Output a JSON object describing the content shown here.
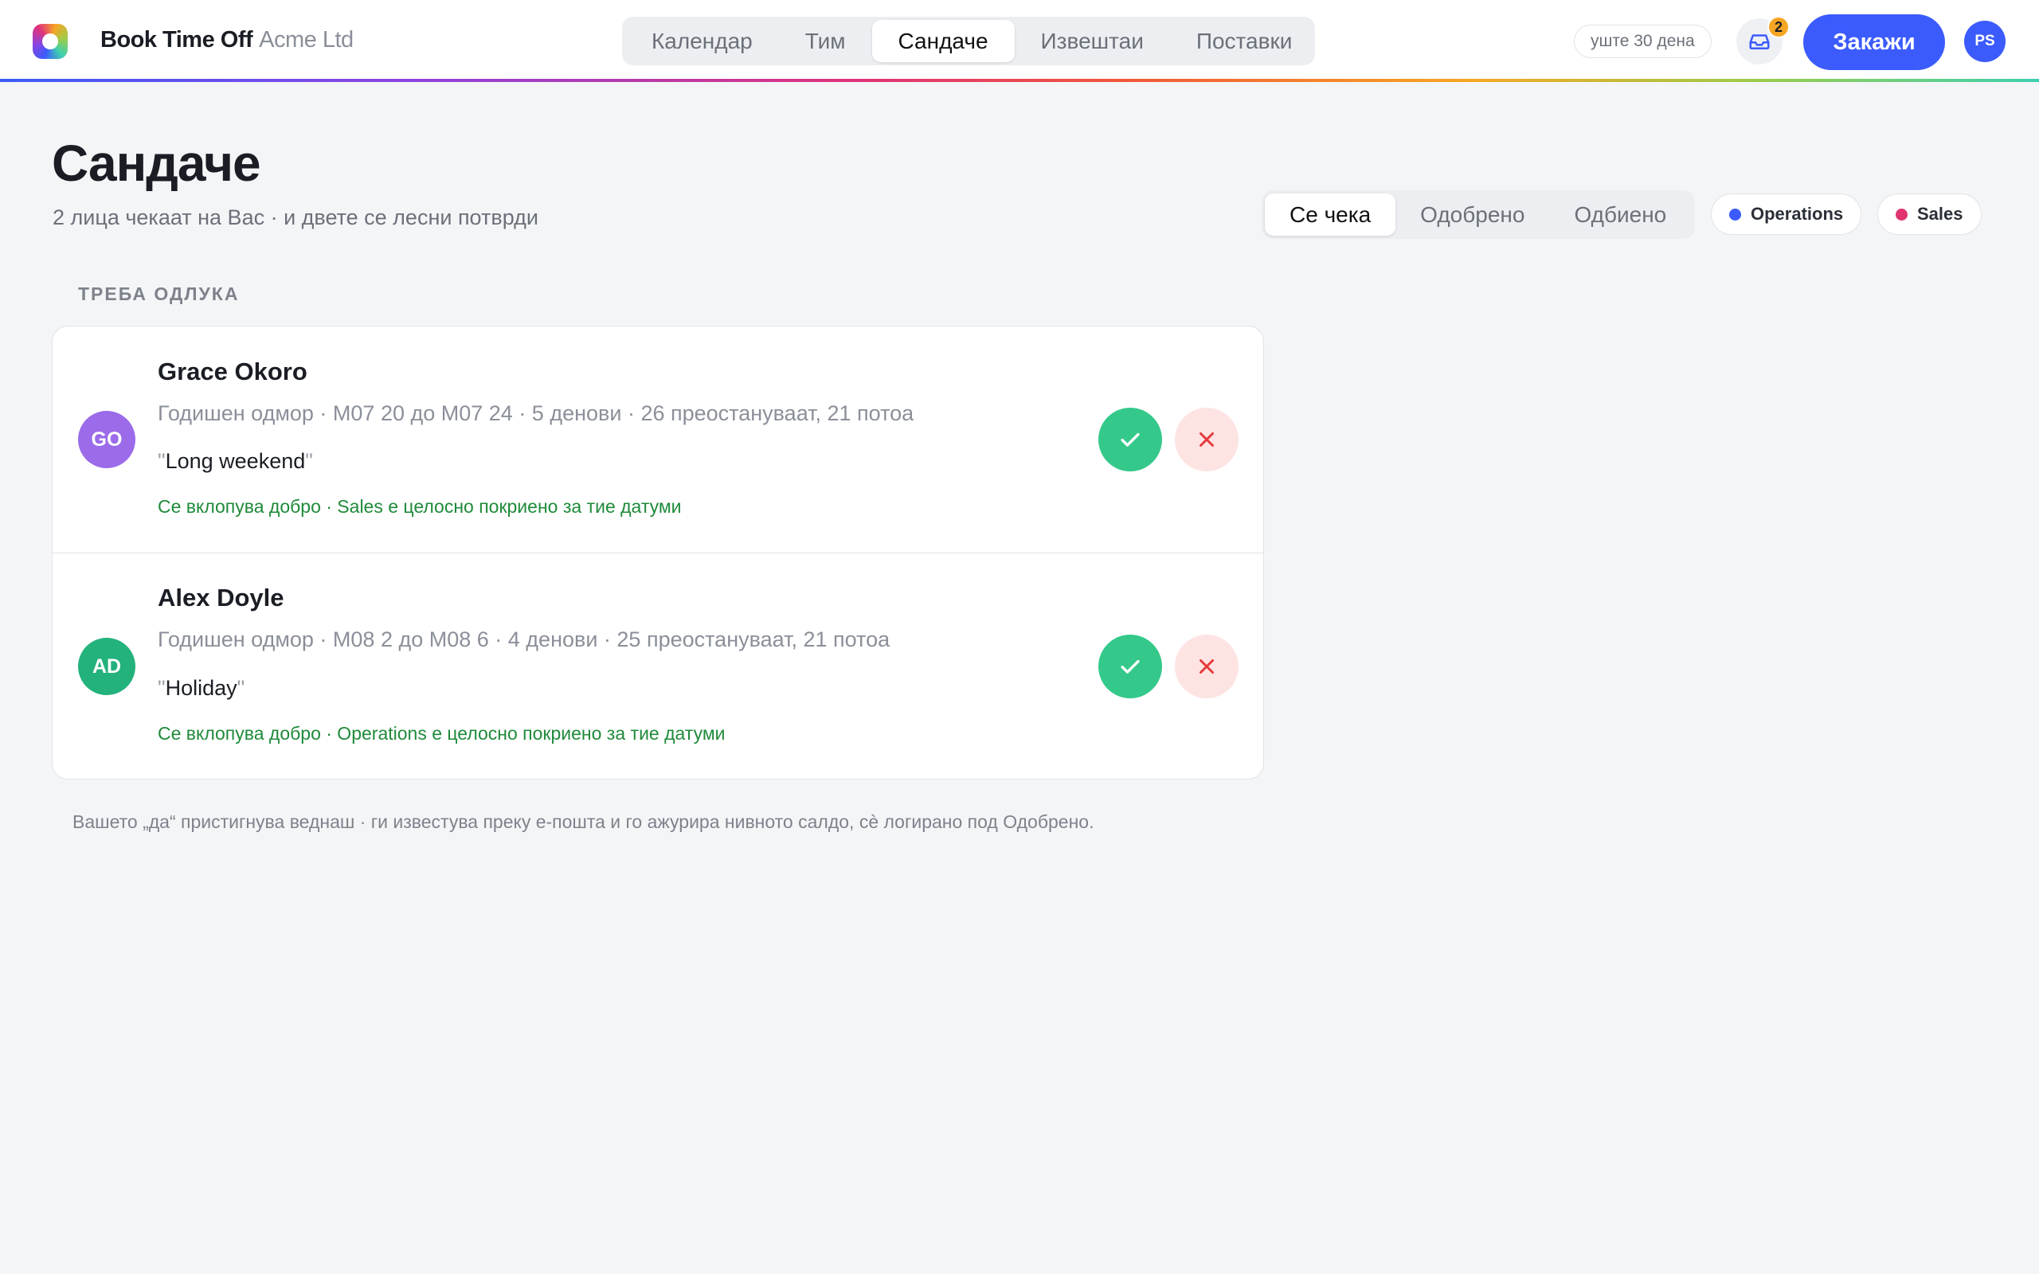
{
  "app": {
    "name": "Book Time Off",
    "org": "Acme Ltd"
  },
  "nav": {
    "tabs": [
      {
        "label": "Календар"
      },
      {
        "label": "Тим"
      },
      {
        "label": "Сандаче",
        "active": true
      },
      {
        "label": "Извештаи"
      },
      {
        "label": "Поставки"
      }
    ]
  },
  "header": {
    "trial": "уште 30 дена",
    "inbox_count": "2",
    "book_button": "Закажи",
    "user_initials": "PS"
  },
  "page": {
    "title": "Сандаче",
    "subtitle": "2 лица чекаат на Вас · и двете се лесни потврди"
  },
  "filters": {
    "tabs": [
      {
        "label": "Се чека",
        "active": true
      },
      {
        "label": "Одобрено"
      },
      {
        "label": "Одбиено"
      }
    ],
    "chips": [
      {
        "label": "Operations",
        "color": "#3b5bfd"
      },
      {
        "label": "Sales",
        "color": "#e0336f"
      }
    ]
  },
  "section": {
    "label": "ТРЕБА ОДЛУКА"
  },
  "requests": [
    {
      "initials": "GO",
      "avatar_color": "#9b6bea",
      "name": "Grace Okoro",
      "meta": "Годишен одмор · M07 20 до M07 24 · 5 денови · 26 преостануваат, 21 потоа",
      "note": "Long weekend",
      "fit": "Се вклопува добро · Sales е целосно покриено за тие датуми"
    },
    {
      "initials": "AD",
      "avatar_color": "#23b27c",
      "name": "Alex Doyle",
      "meta": "Годишен одмор · M08 2 до M08 6 · 4 денови · 25 преостануваат, 21 потоа",
      "note": "Holiday",
      "fit": "Се вклопува добро · Operations е целосно покриено за тие датуми"
    }
  ],
  "footnote": "Вашето „да“ пристигнува веднаш · ги известува преку е-пошта и го ажурира нивното салдо, сè логирано под Одобрено.",
  "colors": {
    "accent": "#3b5bfd",
    "approve": "#34c98a",
    "deny_bg": "#fde4e2",
    "deny_icon": "#e5393a",
    "fit_text": "#1f8a3a",
    "badge": "#f5a623"
  },
  "icons": {
    "logo": "app-logo-icon",
    "inbox": "inbox-icon",
    "approve": "check-icon",
    "deny": "close-icon"
  }
}
